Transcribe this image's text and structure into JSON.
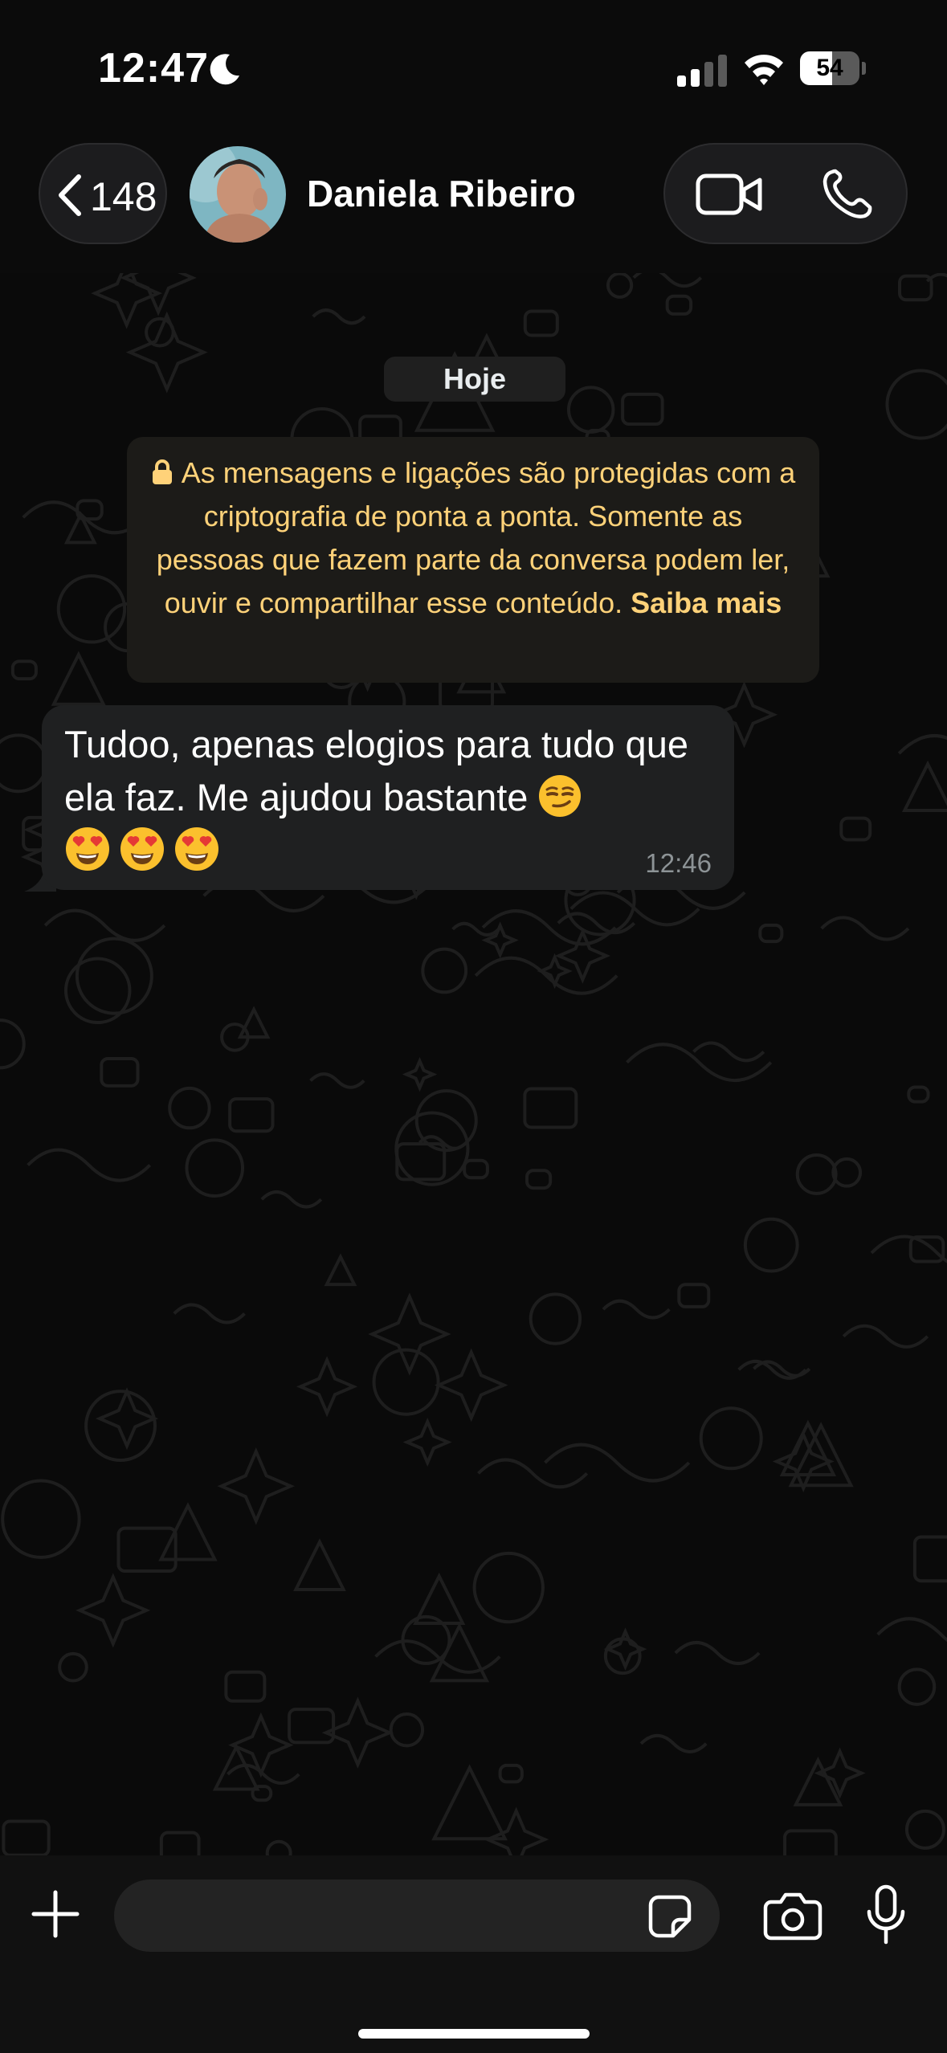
{
  "status_bar": {
    "time": "12:47",
    "battery_level": "54",
    "battery_fraction": 0.54
  },
  "header": {
    "back_count": "148",
    "contact_name": "Daniela Ribeiro"
  },
  "chat": {
    "date_label": "Hoje",
    "encryption_notice": {
      "text": "As mensagens e ligações são protegidas com a criptografia de ponta a ponta. Somente as pessoas que fazem parte da conversa podem ler, ouvir e compartilhar esse conteúdo.",
      "link": "Saiba mais"
    },
    "messages": [
      {
        "text": "Tudoo, apenas elogios para tudo que ela faz. Me ajudou bastante",
        "emojis": [
          "smirking-face",
          "heart-eyes-face",
          "heart-eyes-face",
          "heart-eyes-face"
        ],
        "time": "12:46",
        "direction": "incoming"
      }
    ]
  },
  "input_bar": {
    "placeholder": "",
    "value": ""
  },
  "colors": {
    "background": "#0b0b0b",
    "incoming_bubble": "#1f2021",
    "notice_text": "#ffd279",
    "timestamp": "#8d9396"
  }
}
